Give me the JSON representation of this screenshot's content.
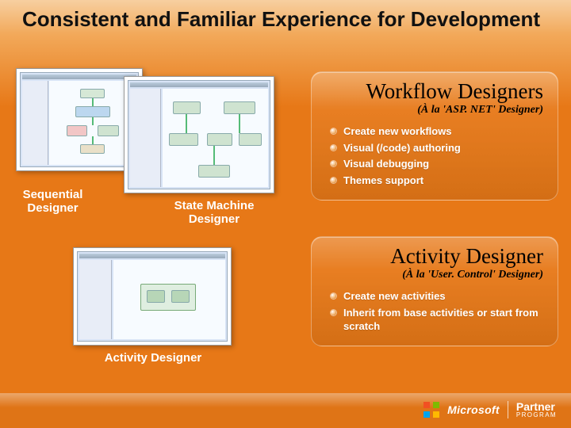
{
  "title": "Consistent and Familiar Experience for Development",
  "captions": {
    "sequential": "Sequential\nDesigner",
    "state_machine": "State Machine\nDesigner",
    "activity": "Activity Designer"
  },
  "panel1": {
    "heading": "Workflow Designers",
    "sub": "(À la 'ASP. NET' Designer)",
    "bullets": [
      "Create new workflows",
      "Visual (/code) authoring",
      "Visual debugging",
      "Themes support"
    ]
  },
  "panel2": {
    "heading": "Activity Designer",
    "sub": "(À la 'User. Control' Designer)",
    "bullets": [
      "Create new activities",
      "Inherit from base activities or start from scratch"
    ]
  },
  "footer": {
    "brand": "Microsoft",
    "program_line1": "Partner",
    "program_line2": "PROGRAM"
  }
}
